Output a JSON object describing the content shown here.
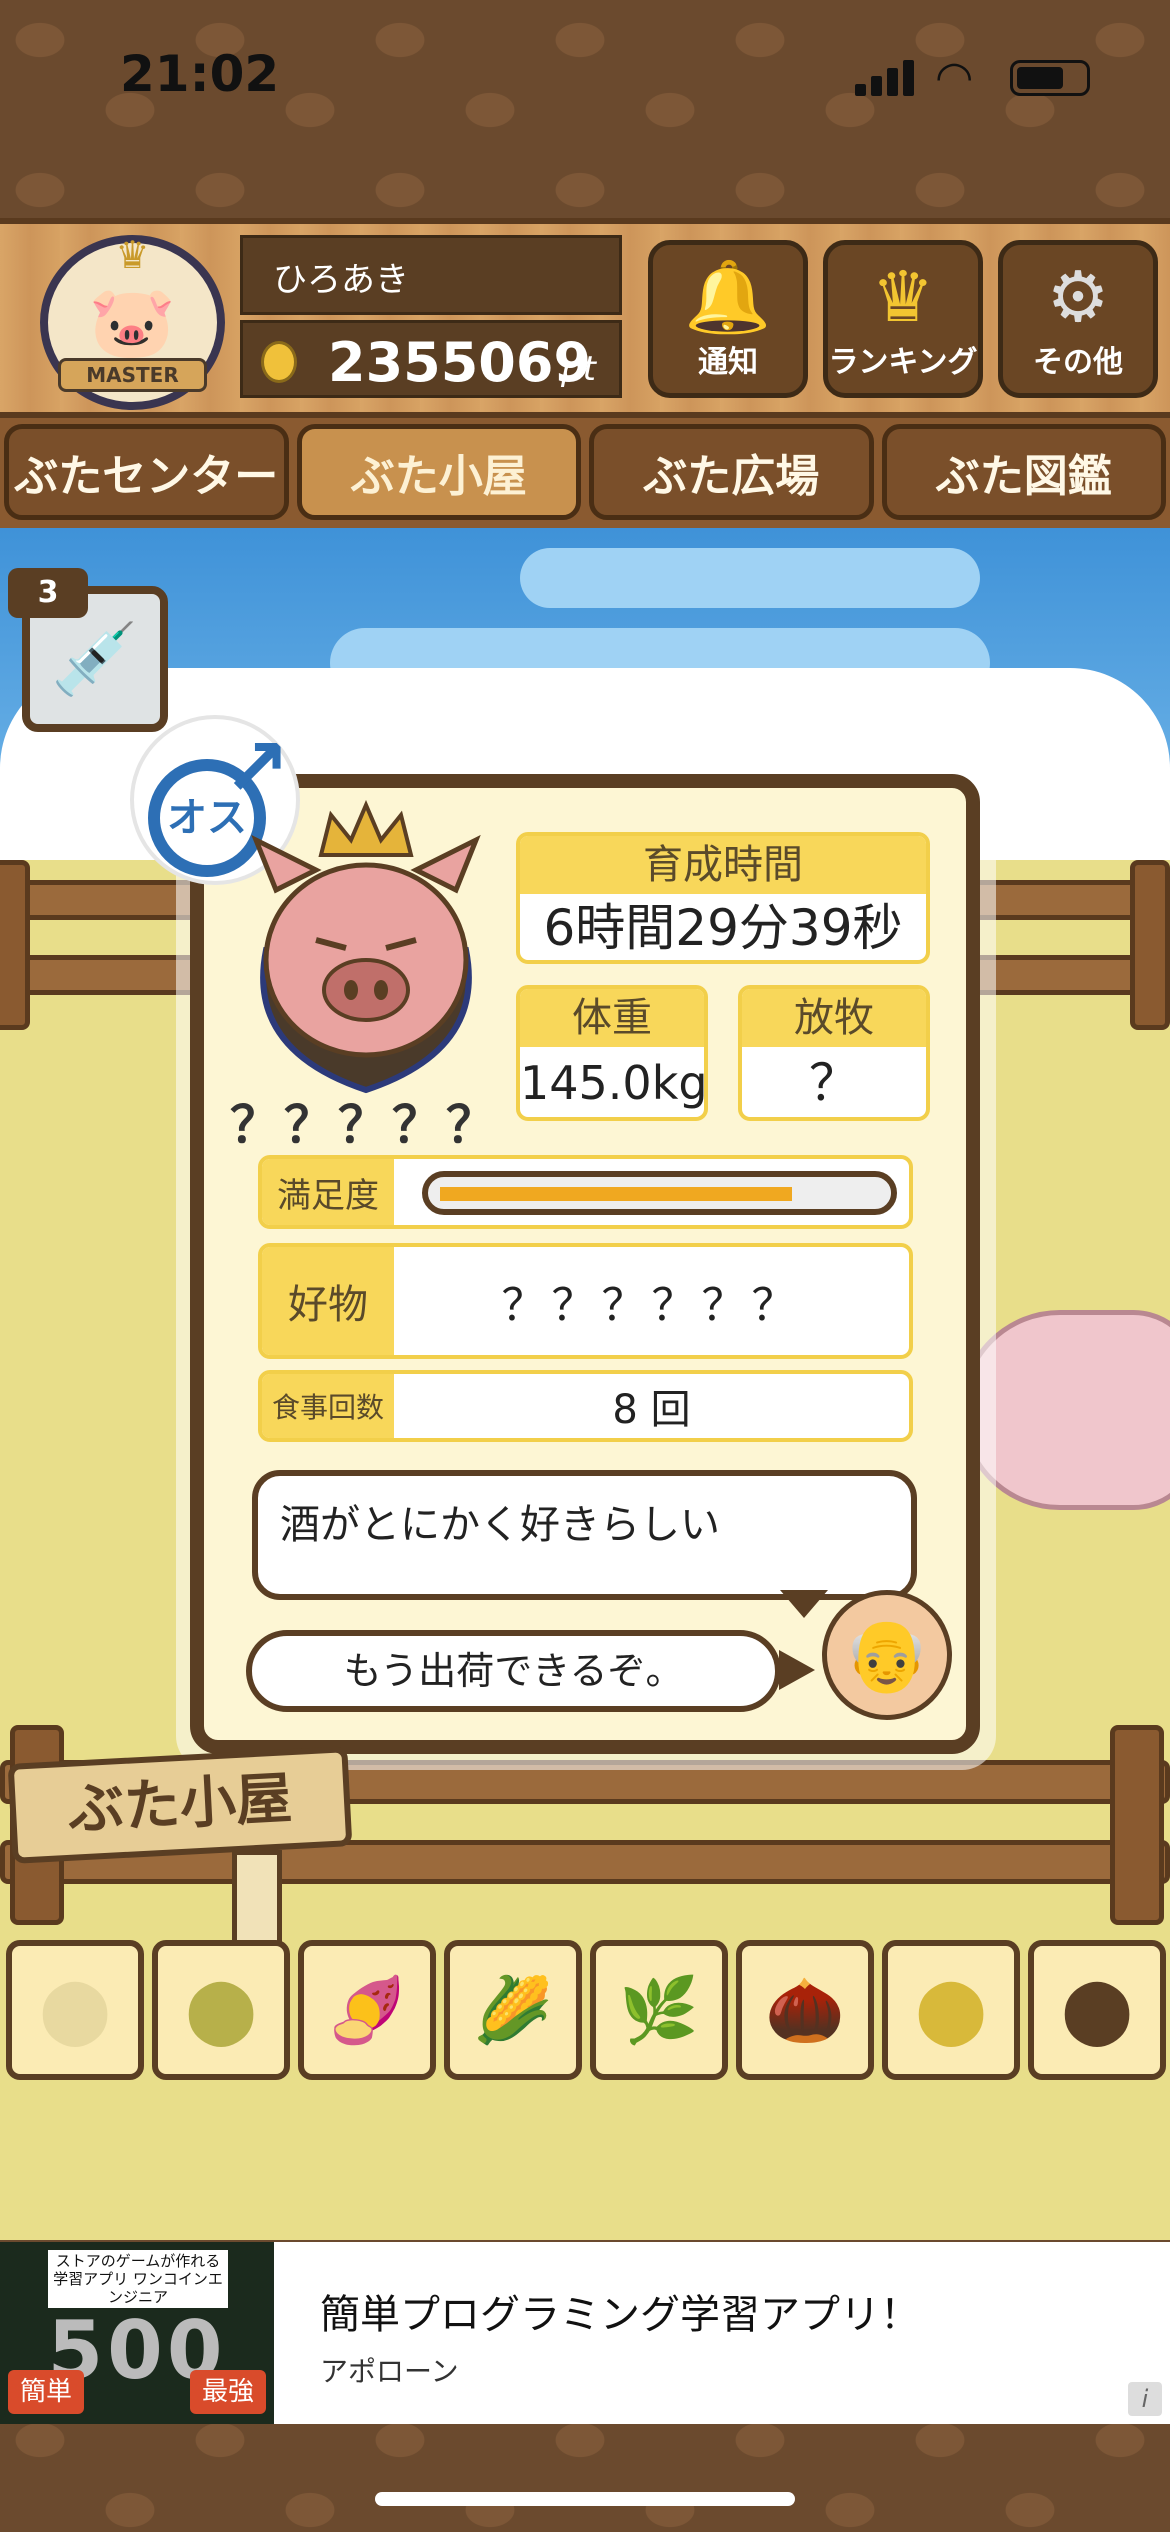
{
  "status_bar": {
    "time": "21:02"
  },
  "header": {
    "badge_label": "MASTER",
    "player_name": "ひろあき",
    "points_value": "2355069",
    "points_unit": "pt",
    "buttons": [
      {
        "label": "通知",
        "icon": "bell-icon"
      },
      {
        "label": "ランキング",
        "icon": "crown-icon"
      },
      {
        "label": "その他",
        "icon": "gear-icon"
      }
    ]
  },
  "nav": {
    "tabs": [
      {
        "label": "ぶたセンター",
        "active": false
      },
      {
        "label": "ぶた小屋",
        "active": true
      },
      {
        "label": "ぶた広場",
        "active": false
      },
      {
        "label": "ぶた図鑑",
        "active": false
      }
    ]
  },
  "item": {
    "count": "3",
    "icon": "syringe-icon"
  },
  "pig": {
    "gender_label": "オス",
    "name": "？？？？？",
    "raising_time_label": "育成時間",
    "raising_time_value": "6時間29分39秒",
    "weight_label": "体重",
    "weight_value": "145.0kg",
    "grazing_label": "放牧",
    "grazing_value": "？",
    "satisfaction_label": "満足度",
    "satisfaction_level": 0.8,
    "favorite_label": "好物",
    "favorite_value": "？？？？？？",
    "meals_label": "食事回数",
    "meals_value": "8 回",
    "comment": "酒がとにかく好きらしい",
    "farmer_message": "もう出荷できるぞ。"
  },
  "sign": {
    "label": "ぶた小屋"
  },
  "foods": [
    {
      "icon": "white-grain-icon"
    },
    {
      "icon": "mixed-grain-icon"
    },
    {
      "icon": "sweet-potato-icon"
    },
    {
      "icon": "corn-icon"
    },
    {
      "icon": "nut-leaf-icon"
    },
    {
      "icon": "acorn-icon"
    },
    {
      "icon": "soybean-icon"
    },
    {
      "icon": "truffle-icon"
    }
  ],
  "ad": {
    "thumb_text": "ストアのゲームが作れる 学習アプリ ワンコインエンジニア",
    "thumb_number": "500",
    "tag_left": "簡単",
    "tag_right": "最強",
    "title": "簡単プログラミング学習アプリ！",
    "advertiser": "アポローン",
    "info": "i"
  }
}
